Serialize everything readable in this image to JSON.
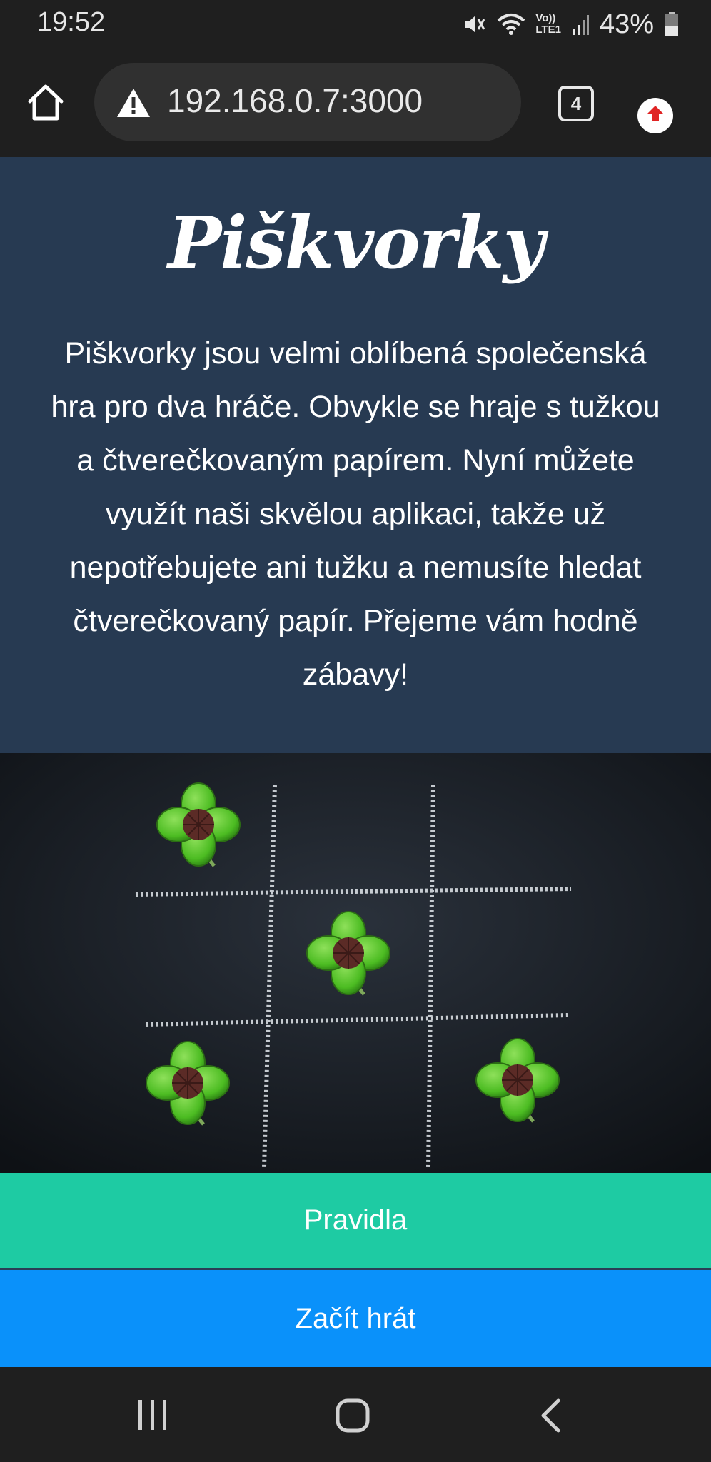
{
  "status_bar": {
    "time": "19:52",
    "battery_percent": "43%",
    "network_label_top": "Vo))",
    "network_label_bottom": "LTE1"
  },
  "browser": {
    "url": "192.168.0.7:3000",
    "tab_count": "4"
  },
  "hero": {
    "title": "Piškvorky",
    "description": "Piškvorky jsou velmi oblíbená společenská hra pro dva hráče. Obvykle se hraje s tužkou a čtverečkovaným papírem. Nyní můžete využít naši skvělou aplikaci, takže už nepotřebujete ani tužku a nemusíte hledat čtverečkovaný papír. Přejeme vám hodně zábavy!"
  },
  "buttons": {
    "rules_label": "Pravidla",
    "start_label": "Začít hrát"
  },
  "colors": {
    "hero_bg": "#273a52",
    "rules_button": "#1ecba3",
    "start_button": "#0a91fa",
    "system_bar": "#1f1f1f"
  },
  "icons": {
    "status": [
      "mute-icon",
      "wifi-icon",
      "signal-icon",
      "battery-icon"
    ],
    "toolbar": [
      "home-icon",
      "warning-icon",
      "tabs-icon",
      "update-icon"
    ],
    "navigation": [
      "recents-icon",
      "home-nav-icon",
      "back-icon"
    ]
  }
}
